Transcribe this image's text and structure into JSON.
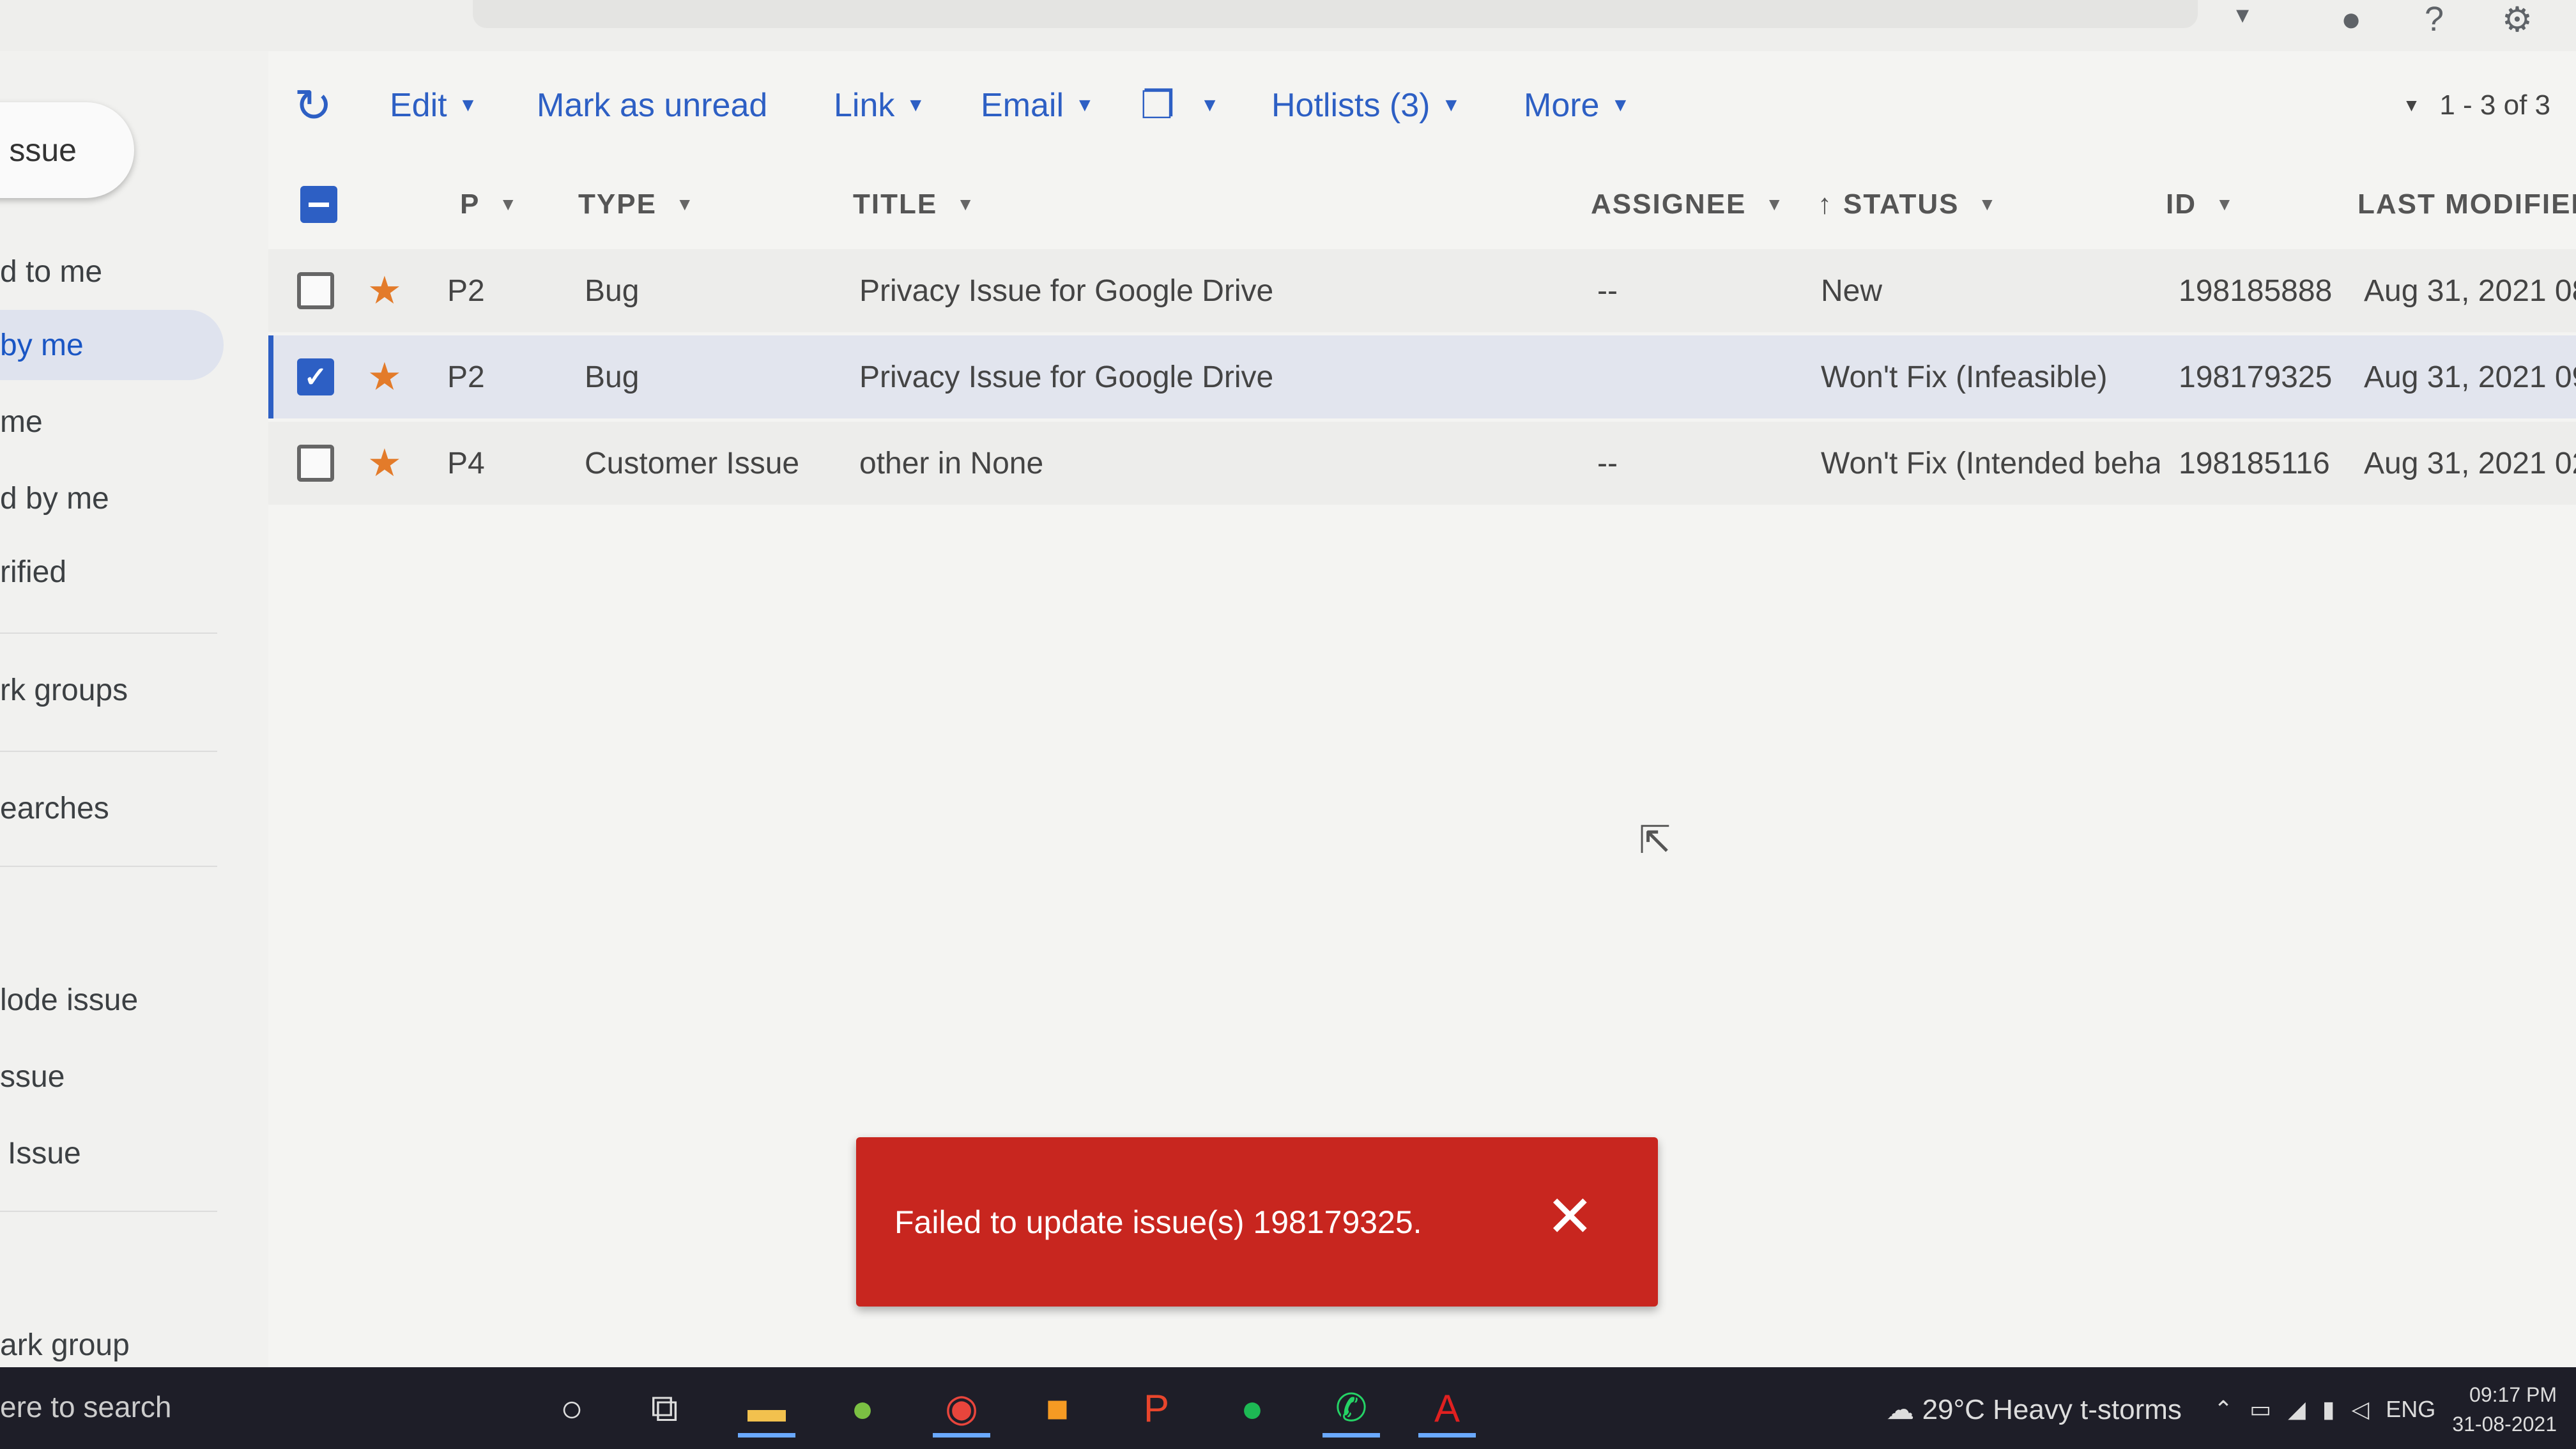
{
  "topbar": {
    "icons": [
      "account-icon",
      "help-icon",
      "settings-icon"
    ]
  },
  "sidebar": {
    "create_label": "ssue",
    "items": [
      {
        "label": "d to me",
        "active": false
      },
      {
        "label": "by me",
        "active": true
      },
      {
        "label": "me",
        "active": false
      },
      {
        "label": "d by me",
        "active": false
      },
      {
        "label": "rified",
        "active": false
      },
      {
        "label": "rk groups",
        "active": false
      },
      {
        "label": "earches",
        "active": false
      },
      {
        "label": "lode issue",
        "active": false
      },
      {
        "label": "ssue",
        "active": false
      },
      {
        "label": "Issue",
        "active": false
      },
      {
        "label": "ark group",
        "active": false
      }
    ]
  },
  "toolbar": {
    "edit": "Edit",
    "mark_unread": "Mark as unread",
    "link": "Link",
    "email": "Email",
    "hotlists": "Hotlists (3)",
    "more": "More",
    "pager": "1 - 3 of 3"
  },
  "table": {
    "columns": [
      "P",
      "TYPE",
      "TITLE",
      "ASSIGNEE",
      "STATUS",
      "ID",
      "LAST MODIFIED"
    ],
    "rows": [
      {
        "checked": false,
        "priority": "P2",
        "type": "Bug",
        "title": "Privacy Issue for Google Drive",
        "assignee": "--",
        "status": "New",
        "id": "198185888",
        "modified": "Aug 31, 2021 08"
      },
      {
        "checked": true,
        "priority": "P2",
        "type": "Bug",
        "title": "Privacy Issue for Google Drive",
        "assignee": "",
        "status": "Won't Fix (Infeasible)",
        "id": "198179325",
        "modified": "Aug 31, 2021 09"
      },
      {
        "checked": false,
        "priority": "P4",
        "type": "Customer Issue",
        "title": "other in None",
        "assignee": "--",
        "status": "Won't Fix (Intended beha",
        "id": "198185116",
        "modified": "Aug 31, 2021 02"
      }
    ]
  },
  "toast": {
    "message": "Failed to update issue(s) 198179325."
  },
  "taskbar": {
    "search": "ere to search",
    "weather": "29°C  Heavy t-storms",
    "lang": "ENG",
    "time": "09:17 PM",
    "date": "31-08-2021"
  },
  "colors": {
    "accent": "#2d5fc4",
    "toast": "#c8261f",
    "star": "#e37b2a"
  }
}
